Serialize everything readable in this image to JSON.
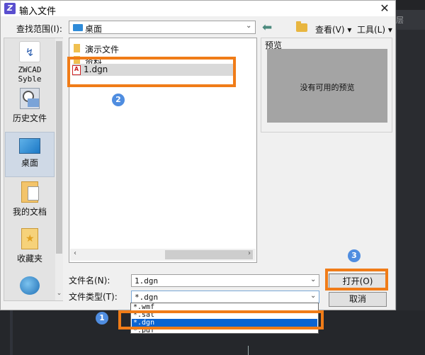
{
  "background": {
    "layer_text": "层"
  },
  "dialog": {
    "title": "输入文件",
    "close_glyph": "✕",
    "look_in": {
      "label": "查找范围(I):",
      "value": "桌面"
    },
    "toolbar": {
      "view_label": "查看(V) ▾",
      "tools_label": "工具(L) ▾"
    },
    "places": [
      {
        "label": "ZWCAD Syble"
      },
      {
        "label": "历史文件"
      },
      {
        "label": "桌面"
      },
      {
        "label": "我的文档"
      },
      {
        "label": "收藏夹"
      }
    ],
    "files": [
      {
        "name": "演示文件",
        "kind": "folder"
      },
      {
        "name": "资料",
        "kind": "folder"
      },
      {
        "name": "1.dgn",
        "kind": "dgn"
      }
    ],
    "preview": {
      "label": "预览",
      "message": "没有可用的预览"
    },
    "file_name": {
      "label": "文件名(N):",
      "value": "1.dgn"
    },
    "file_type": {
      "label": "文件类型(T):",
      "value": "*.dgn",
      "options": [
        "*.wmf",
        "*.sat",
        "*.dgn",
        "*.pdf"
      ]
    },
    "buttons": {
      "open": "打开(O)",
      "cancel": "取消"
    }
  },
  "annotations": [
    "1",
    "2",
    "3"
  ],
  "colors": {
    "highlight": "#f07c18",
    "badge": "#4f8de0",
    "selected_option": "#0a64d2"
  }
}
